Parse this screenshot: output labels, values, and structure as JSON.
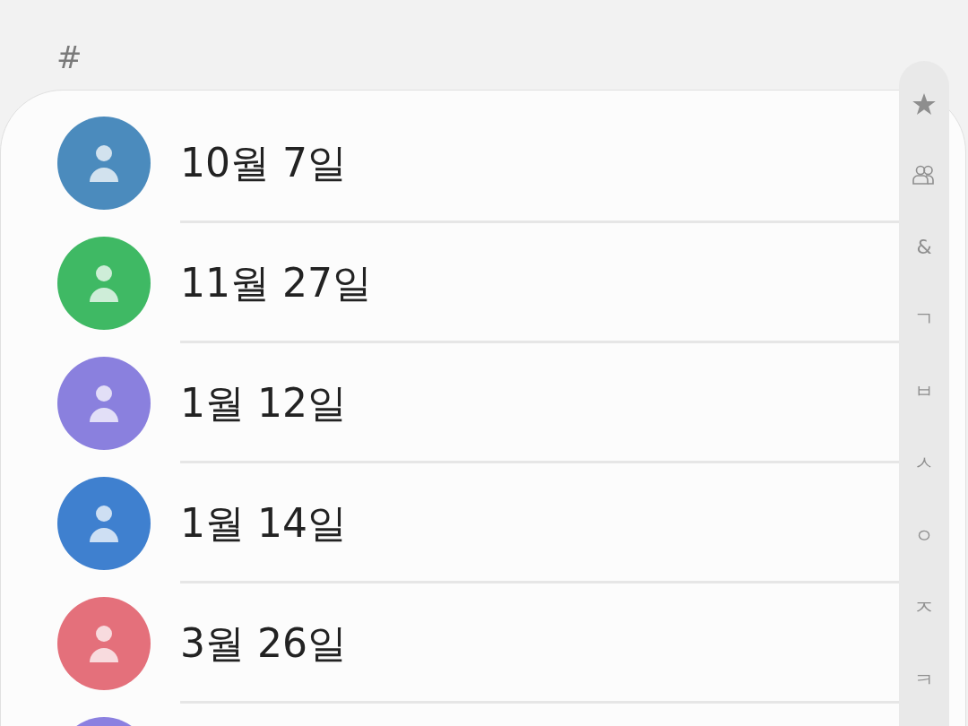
{
  "section_header": "#",
  "contacts": [
    {
      "name": "10월 7일",
      "color": "#4b8bbd"
    },
    {
      "name": "11월 27일",
      "color": "#3fb964"
    },
    {
      "name": "1월 12일",
      "color": "#8a80de"
    },
    {
      "name": "1월 14일",
      "color": "#3f80cf"
    },
    {
      "name": "3월 26일",
      "color": "#e4707b"
    },
    {
      "color": "#8b80e0"
    }
  ],
  "index_bar": [
    {
      "kind": "star"
    },
    {
      "kind": "group"
    },
    {
      "kind": "text",
      "label": "&"
    },
    {
      "kind": "text",
      "label": "ㄱ"
    },
    {
      "kind": "text",
      "label": "ㅂ"
    },
    {
      "kind": "text",
      "label": "ㅅ"
    },
    {
      "kind": "text",
      "label": "ㅇ"
    },
    {
      "kind": "text",
      "label": "ㅈ"
    },
    {
      "kind": "text",
      "label": "ㅋ"
    }
  ]
}
